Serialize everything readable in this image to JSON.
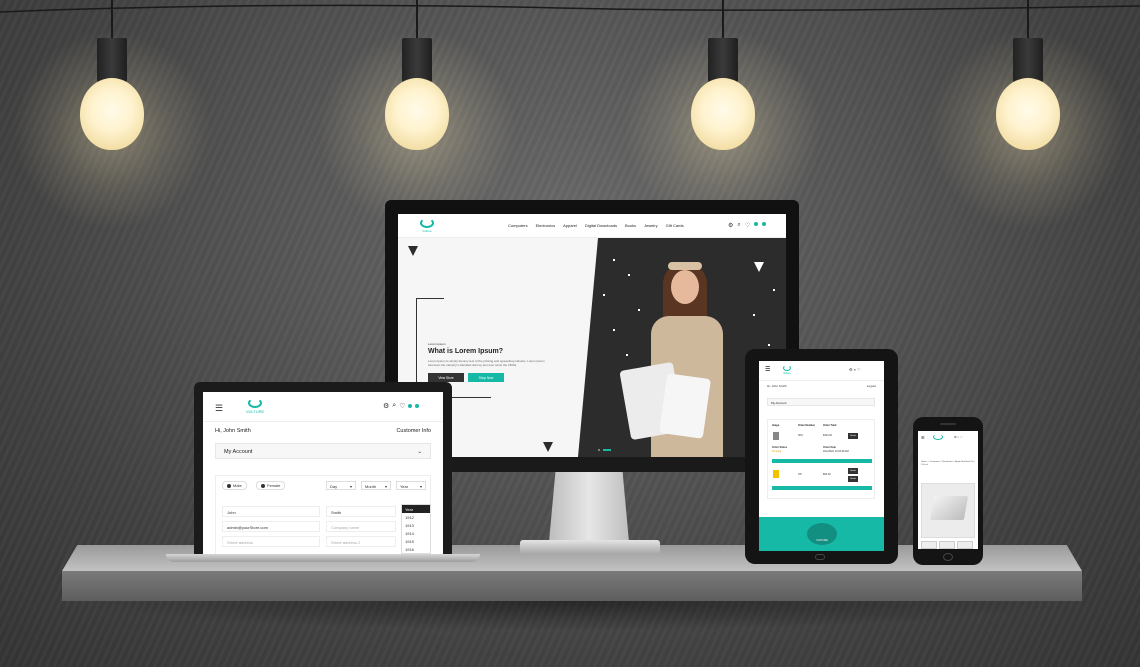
{
  "monitor": {
    "brand": "Vulture",
    "nav": [
      "Computers",
      "Electronics",
      "Apparel",
      "Digital Downloads",
      "Books",
      "Jewelry",
      "Gift Cards"
    ],
    "hero_eyebrow": "Lorem Ipsum",
    "hero_title": "What is Lorem Ipsum?",
    "hero_text": "Lorem Ipsum is simply dummy text of the printing and typesetting industry. Lorem Ipsum has been the industry's standard dummy text ever since the 1500s.",
    "btn_primary": "View Store",
    "btn_secondary": "Shop Now",
    "cart_count": "0"
  },
  "laptop": {
    "brand": "VULTURE",
    "greeting": "Hi, John Smith",
    "section_title": "Customer Info",
    "account_label": "My Account",
    "gender_male": "Male",
    "gender_female": "Female",
    "day": "Day",
    "month": "Month",
    "year": "Year",
    "first_name": "John",
    "last_name": "Smith",
    "email": "admin@yourStore.com",
    "company_placeholder": "Company name",
    "street1_placeholder": "Street address",
    "street2_placeholder": "Street address 2",
    "years": [
      "Year",
      "1912",
      "1913",
      "1914",
      "1915",
      "1916"
    ]
  },
  "tablet": {
    "brand": "Vulture",
    "greeting": "Hi, John Smith",
    "logout": "Logout",
    "account_label": "My Account",
    "headers": [
      "Image",
      "Order Number",
      "Order Total"
    ],
    "row1": [
      "SKU",
      "$344.00"
    ],
    "status_label": "Order Status",
    "status_value": "Pending",
    "date_label": "Order Date",
    "date_value": "4/11/2022 10:33:46 AM",
    "row2": [
      "OP",
      "$93.00"
    ],
    "details": "Details",
    "footer_brand": "VULTURE"
  },
  "phone": {
    "crumb": "Home » Computers » Notebooks » Apple MacBook Pro 13-inch"
  },
  "colors": {
    "accent": "#16b8a6",
    "dark": "#2c2c2c"
  }
}
